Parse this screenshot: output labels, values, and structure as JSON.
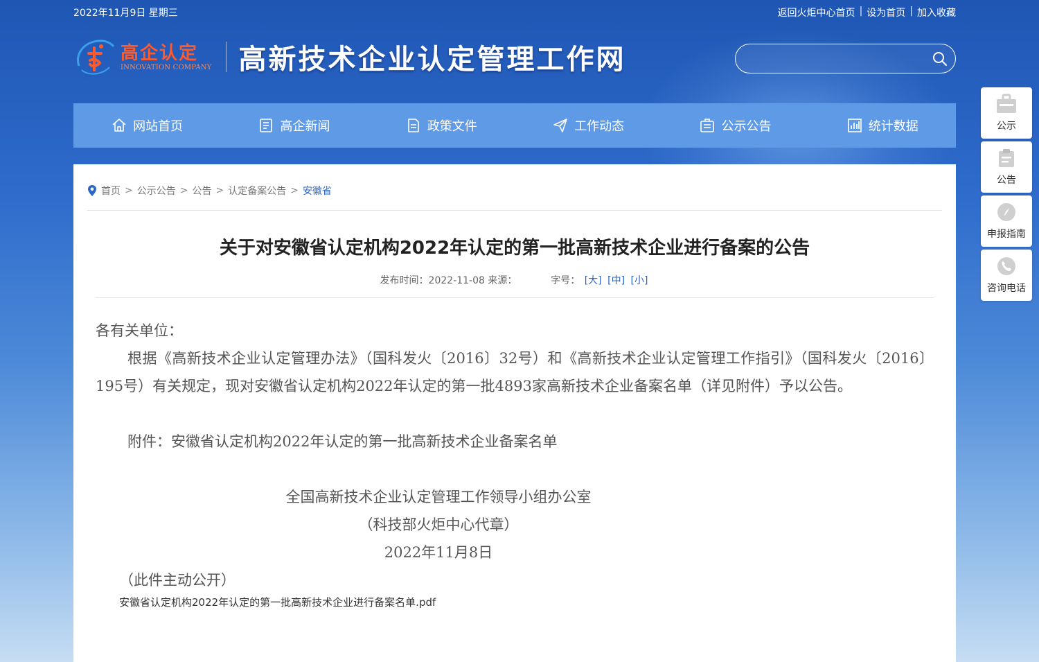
{
  "topbar": {
    "date": "2022年11月9日 星期三",
    "links": [
      "返回火炬中心首页",
      "设为首页",
      "加入收藏"
    ],
    "separator": "|"
  },
  "brand": {
    "logo_cn": "高企认定",
    "logo_en": "INNOVATION COMPANY",
    "site_title": "高新技术企业认定管理工作网"
  },
  "search": {
    "placeholder": ""
  },
  "nav": [
    {
      "label": "网站首页",
      "icon": "home-icon"
    },
    {
      "label": "高企新闻",
      "icon": "news-icon"
    },
    {
      "label": "政策文件",
      "icon": "document-icon"
    },
    {
      "label": "工作动态",
      "icon": "paper-plane-icon"
    },
    {
      "label": "公示公告",
      "icon": "notice-icon"
    },
    {
      "label": "统计数据",
      "icon": "chart-icon"
    }
  ],
  "breadcrumb": {
    "items": [
      "首页",
      "公示公告",
      "公告",
      "认定备案公告"
    ],
    "current": "安徽省",
    "separator": ">"
  },
  "article": {
    "title": "关于对安徽省认定机构2022年认定的第一批高新技术企业进行备案的公告",
    "meta_published": "发布时间：2022-11-08 来源：",
    "meta_fontsize_label": "字号：",
    "font_large": "[大]",
    "font_medium": "[中]",
    "font_small": "[小]",
    "salutation": "各有关单位：",
    "body": "根据《高新技术企业认定管理办法》（国科发火〔2016〕32号）和《高新技术企业认定管理工作指引》（国科发火〔2016〕195号）有关规定，现对安徽省认定机构2022年认定的第一批4893家高新技术企业备案名单（详见附件）予以公告。",
    "attachment": "附件：安徽省认定机构2022年认定的第一批高新技术企业备案名单",
    "signoff_org": "全国高新技术企业认定管理工作领导小组办公室",
    "signoff_sub": "（科技部火炬中心代章）",
    "signoff_date": "2022年11月8日",
    "public_note": "（此件主动公开）",
    "pdf_link": "安徽省认定机构2022年认定的第一批高新技术企业进行备案名单.pdf"
  },
  "float_bar": [
    {
      "label": "公示",
      "icon": "briefcase-icon"
    },
    {
      "label": "公告",
      "icon": "clipboard-icon"
    },
    {
      "label": "申报指南",
      "icon": "compass-icon"
    },
    {
      "label": "咨询电话",
      "icon": "phone-icon"
    }
  ],
  "colors": {
    "nav_bg": "#5f9ae6",
    "accent_blue": "#2c66c8",
    "logo_orange": "#ff5a2c"
  }
}
